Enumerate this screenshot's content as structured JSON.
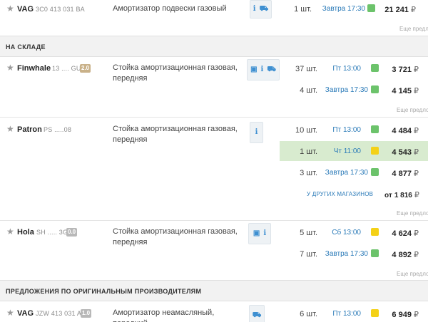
{
  "rows": {
    "vag1": {
      "brand": "VAG",
      "article": "3C0 413 031 BA",
      "desc": "Амортизатор подвески газовый",
      "qty": "1 шт.",
      "delivery": "Завтра 17:30",
      "price": "21 241",
      "currency": "₽",
      "more": "Еще предл"
    },
    "finwhale": {
      "brand": "Finwhale",
      "article": "13 .... GU",
      "badge": "2.0",
      "desc": "Стойка амортизационная газовая, передняя",
      "offers": [
        {
          "qty": "37 шт.",
          "delivery": "Пт 13:00",
          "price": "3 721",
          "status": "green"
        },
        {
          "qty": "4 шт.",
          "delivery": "Завтра 17:30",
          "price": "4 145",
          "status": "green"
        }
      ],
      "more": "Еще предло"
    },
    "patron": {
      "brand": "Patron",
      "article": "PS .....08",
      "desc": "Стойка амортизационная газовая, передняя",
      "offers": [
        {
          "qty": "10 шт.",
          "delivery": "Пт 13:00",
          "price": "4 484",
          "status": "green"
        },
        {
          "qty": "1 шт.",
          "delivery": "Чт 11:00",
          "price": "4 543",
          "status": "yellow"
        },
        {
          "qty": "3 шт.",
          "delivery": "Завтра 17:30",
          "price": "4 877",
          "status": "green"
        }
      ],
      "other_link": "У ДРУГИХ МАГАЗИНОВ",
      "other_from": "от",
      "other_price": "1 816",
      "more": "Еще предло"
    },
    "hola": {
      "brand": "Hola",
      "article": "SH ..... 3G",
      "badge": "0.0",
      "desc": "Стойка амортизационная газовая, передняя",
      "offers": [
        {
          "qty": "5 шт.",
          "delivery": "Сб 13:00",
          "price": "4 624",
          "status": "yellow"
        },
        {
          "qty": "7 шт.",
          "delivery": "Завтра 17:30",
          "price": "4 892",
          "status": "green"
        }
      ],
      "more": "Еще предло"
    },
    "vag2": {
      "brand": "VAG",
      "article": "JZW 413 031 A",
      "badge": "1.0",
      "desc": "Амортизатор неамасляный, передний",
      "qty": "6 шт.",
      "delivery": "Пт 13:00",
      "price": "6 949",
      "status": "yellow"
    }
  },
  "sections": {
    "stock": "НА СКЛАДЕ",
    "original": "ПРЕДЛОЖЕНИЯ ПО ОРИГИНАЛЬНЫМ ПРОИЗВОДИТЕЛЯМ"
  },
  "icons": {
    "star": "star-icon",
    "info": "info-icon",
    "car": "car-icon",
    "camera": "camera-icon"
  },
  "colors": {
    "green": "#6cc36b",
    "yellow": "#f4d117",
    "highlight": "#d8ebcf",
    "link": "#2a7ab8"
  }
}
